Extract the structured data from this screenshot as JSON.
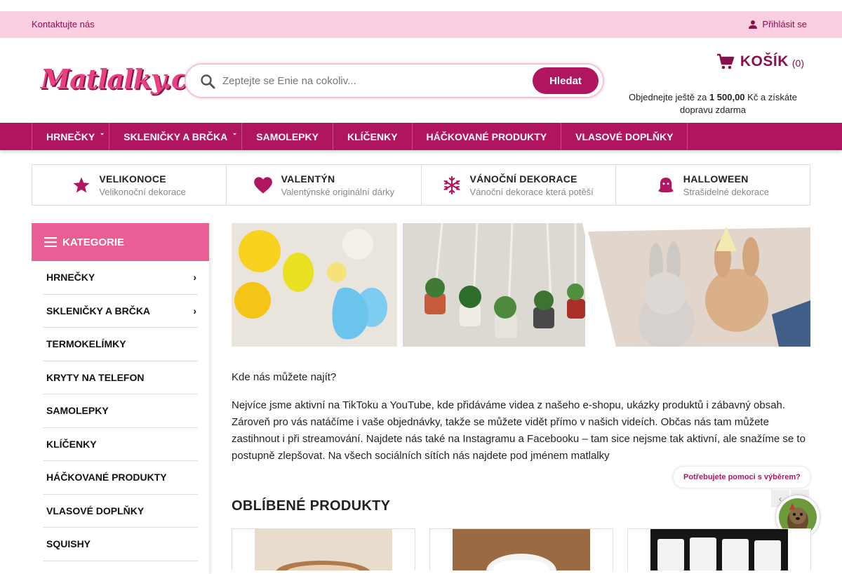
{
  "topbar": {
    "contact": "Kontaktujte nás",
    "login": "Přihlásit se"
  },
  "header": {
    "logo": "Matlalky.cz",
    "search_placeholder": "Zeptejte se Enie na cokoliv...",
    "search_button": "Hledat",
    "cart_label": "KOŠÍK",
    "cart_count": "(0)",
    "freeship_before": "Objednejte ještě za",
    "freeship_amount": "1 500,00",
    "freeship_after": "Kč a získáte dopravu zdarma"
  },
  "nav": [
    {
      "label": "HRNEČKY",
      "has_sub": true
    },
    {
      "label": "SKLENIČKY A BRČKA",
      "has_sub": true
    },
    {
      "label": "SAMOLEPKY",
      "has_sub": false
    },
    {
      "label": "KLÍČENKY",
      "has_sub": false
    },
    {
      "label": "HÁČKOVANÉ PRODUKTY",
      "has_sub": false
    },
    {
      "label": "VLASOVÉ DOPLŇKY",
      "has_sub": false
    }
  ],
  "seasons": [
    {
      "title": "VELIKONOCE",
      "subtitle": "Velikonoční dekorace",
      "icon": "star-icon"
    },
    {
      "title": "VALENTÝN",
      "subtitle": "Valentýnské originální dárky",
      "icon": "heart-icon"
    },
    {
      "title": "VÁNOČNÍ DEKORACE",
      "subtitle": "Vánoční dekorace která potěší",
      "icon": "snowflake-icon"
    },
    {
      "title": "HALLOWEEN",
      "subtitle": "Strašidelné dekorace",
      "icon": "ghost-icon"
    }
  ],
  "sidebar": {
    "title": "KATEGORIE",
    "items": [
      {
        "label": "HRNEČKY",
        "arrow": true
      },
      {
        "label": "SKLENIČKY A BRČKA",
        "arrow": true
      },
      {
        "label": "TERMOKELÍMKY",
        "arrow": false
      },
      {
        "label": "KRYTY NA TELEFON",
        "arrow": false
      },
      {
        "label": "SAMOLEPKY",
        "arrow": false
      },
      {
        "label": "KLÍČENKY",
        "arrow": false
      },
      {
        "label": "HÁČKOVANÉ PRODUKTY",
        "arrow": false
      },
      {
        "label": "VLASOVÉ DOPLŇKY",
        "arrow": false
      },
      {
        "label": "SQUISHY",
        "arrow": false
      }
    ]
  },
  "content": {
    "where": " Kde nás můžete najít?",
    "body": "Nejvíce jsme aktivní na TikToku a YouTube, kde přidáváme videa z našeho e-shopu, ukázky produktů i zábavný obsah.  Zároveň pro vás natáčíme i vaše objednávky, takže se můžete vidět přímo v našich videích.  Občas nás tam můžete zastihnout i při streamování. Najdete nás také na Instagramu a Facebooku – tam sice nejsme tak aktivní, ale snažíme se to postupně zlepšovat.   Na všech sociálních sítích nás najdete pod jménem matlalky",
    "popular_title": "OBLÍBENÉ PRODUKTY"
  },
  "help_bubble": "Potřebujete pomoci s výběrem?",
  "colors": {
    "accent": "#b0155f",
    "pink_light": "#f9cfe1",
    "pink": "#ea5d95"
  }
}
